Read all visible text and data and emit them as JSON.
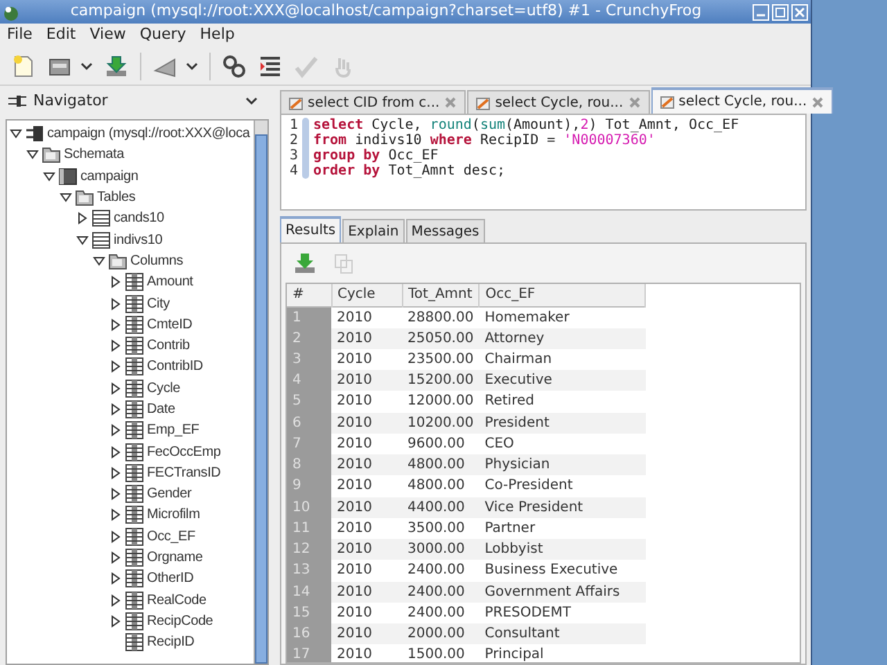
{
  "window": {
    "title": "campaign (mysql://root:XXX@localhost/campaign?charset=utf8) #1 - CrunchyFrog"
  },
  "menu": [
    "File",
    "Edit",
    "View",
    "Query",
    "Help"
  ],
  "toolbar": [
    {
      "disabled": false,
      "dropdown": false
    },
    {
      "disabled": false,
      "dropdown": true
    },
    {
      "disabled": false,
      "dropdown": false
    },
    {
      "disabled": false,
      "dropdown": true
    },
    {
      "disabled": false,
      "dropdown": false
    },
    {
      "disabled": false,
      "dropdown": false
    },
    {
      "disabled": true,
      "dropdown": false
    },
    {
      "disabled": true,
      "dropdown": false
    }
  ],
  "navigator": {
    "title": "Navigator"
  },
  "tree": [
    {
      "label": "campaign (mysql://root:XXX@loca",
      "kind": "connection",
      "expanded": true,
      "children": [
        {
          "label": "Schemata",
          "kind": "folder",
          "expanded": true,
          "children": [
            {
              "label": "campaign",
              "kind": "schema",
              "expanded": true,
              "children": [
                {
                  "label": "Tables",
                  "kind": "folder",
                  "expanded": true,
                  "children": [
                    {
                      "label": "cands10",
                      "kind": "table",
                      "expanded": false
                    },
                    {
                      "label": "indivs10",
                      "kind": "table",
                      "expanded": true,
                      "children": [
                        {
                          "label": "Columns",
                          "kind": "folder",
                          "expanded": true,
                          "children": [
                            {
                              "label": "Amount",
                              "kind": "column",
                              "expanded": false
                            },
                            {
                              "label": "City",
                              "kind": "column",
                              "expanded": false
                            },
                            {
                              "label": "CmteID",
                              "kind": "column",
                              "expanded": false
                            },
                            {
                              "label": "Contrib",
                              "kind": "column",
                              "expanded": false
                            },
                            {
                              "label": "ContribID",
                              "kind": "column",
                              "expanded": false
                            },
                            {
                              "label": "Cycle",
                              "kind": "column",
                              "expanded": false
                            },
                            {
                              "label": "Date",
                              "kind": "column",
                              "expanded": false
                            },
                            {
                              "label": "Emp_EF",
                              "kind": "column",
                              "expanded": false
                            },
                            {
                              "label": "FecOccEmp",
                              "kind": "column",
                              "expanded": false
                            },
                            {
                              "label": "FECTransID",
                              "kind": "column",
                              "expanded": false
                            },
                            {
                              "label": "Gender",
                              "kind": "column",
                              "expanded": false
                            },
                            {
                              "label": "Microfilm",
                              "kind": "column",
                              "expanded": false
                            },
                            {
                              "label": "Occ_EF",
                              "kind": "column",
                              "expanded": false
                            },
                            {
                              "label": "Orgname",
                              "kind": "column",
                              "expanded": false
                            },
                            {
                              "label": "OtherID",
                              "kind": "column",
                              "expanded": false
                            },
                            {
                              "label": "RealCode",
                              "kind": "column",
                              "expanded": false
                            },
                            {
                              "label": "RecipCode",
                              "kind": "column",
                              "expanded": false
                            },
                            {
                              "label": "RecipID",
                              "kind": "column"
                            }
                          ]
                        }
                      ]
                    }
                  ]
                }
              ]
            }
          ]
        }
      ]
    }
  ],
  "editor_tabs": [
    {
      "label": "select CID from c...",
      "selected": false
    },
    {
      "label": "select Cycle, rou...",
      "selected": false
    },
    {
      "label": "select Cycle, rou...",
      "selected": true
    }
  ],
  "editor": {
    "lines": [
      {
        "number": "1",
        "tokens": [
          {
            "kind": "keyword",
            "text": "select"
          },
          {
            "kind": "plain",
            "text": " Cycle, "
          },
          {
            "kind": "function",
            "text": "round"
          },
          {
            "kind": "plain",
            "text": "("
          },
          {
            "kind": "function",
            "text": "sum"
          },
          {
            "kind": "plain",
            "text": "(Amount),"
          },
          {
            "kind": "number",
            "text": "2"
          },
          {
            "kind": "plain",
            "text": ") Tot_Amnt, Occ_EF"
          }
        ]
      },
      {
        "number": "2",
        "tokens": [
          {
            "kind": "keyword",
            "text": "from"
          },
          {
            "kind": "plain",
            "text": " indivs10 "
          },
          {
            "kind": "keyword",
            "text": "where"
          },
          {
            "kind": "plain",
            "text": " RecipID = "
          },
          {
            "kind": "string",
            "text": "'N00007360'"
          }
        ]
      },
      {
        "number": "3",
        "tokens": [
          {
            "kind": "keyword",
            "text": "group by"
          },
          {
            "kind": "plain",
            "text": " Occ_EF"
          }
        ]
      },
      {
        "number": "4",
        "tokens": [
          {
            "kind": "keyword",
            "text": "order by"
          },
          {
            "kind": "plain",
            "text": " Tot_Amnt desc;"
          }
        ]
      }
    ]
  },
  "result_tabs": [
    {
      "label": "Results",
      "selected": true
    },
    {
      "label": "Explain",
      "selected": false
    },
    {
      "label": "Messages",
      "selected": false
    }
  ],
  "result_toolbar": [
    {
      "disabled": false
    },
    {
      "disabled": true
    }
  ],
  "table": {
    "columns": [
      "#",
      "Cycle",
      "Tot_Amnt",
      "Occ_EF"
    ],
    "rows": [
      [
        "1",
        "2010",
        "28800.00",
        "Homemaker"
      ],
      [
        "2",
        "2010",
        "25050.00",
        "Attorney"
      ],
      [
        "3",
        "2010",
        "23500.00",
        "Chairman"
      ],
      [
        "4",
        "2010",
        "15200.00",
        "Executive"
      ],
      [
        "5",
        "2010",
        "12000.00",
        "Retired"
      ],
      [
        "6",
        "2010",
        "10200.00",
        "President"
      ],
      [
        "7",
        "2010",
        "9600.00",
        "CEO"
      ],
      [
        "8",
        "2010",
        "4800.00",
        "Physician"
      ],
      [
        "9",
        "2010",
        "4800.00",
        "Co-President"
      ],
      [
        "10",
        "2010",
        "4400.00",
        "Vice President"
      ],
      [
        "11",
        "2010",
        "3500.00",
        "Partner"
      ],
      [
        "12",
        "2010",
        "3000.00",
        "Lobbyist"
      ],
      [
        "13",
        "2010",
        "2400.00",
        "Business Executive"
      ],
      [
        "14",
        "2010",
        "2400.00",
        "Government Affairs"
      ],
      [
        "15",
        "2010",
        "2400.00",
        "PRESODEMT"
      ],
      [
        "16",
        "2010",
        "2000.00",
        "Consultant"
      ],
      [
        "17",
        "2010",
        "1500.00",
        "Principal"
      ]
    ]
  }
}
